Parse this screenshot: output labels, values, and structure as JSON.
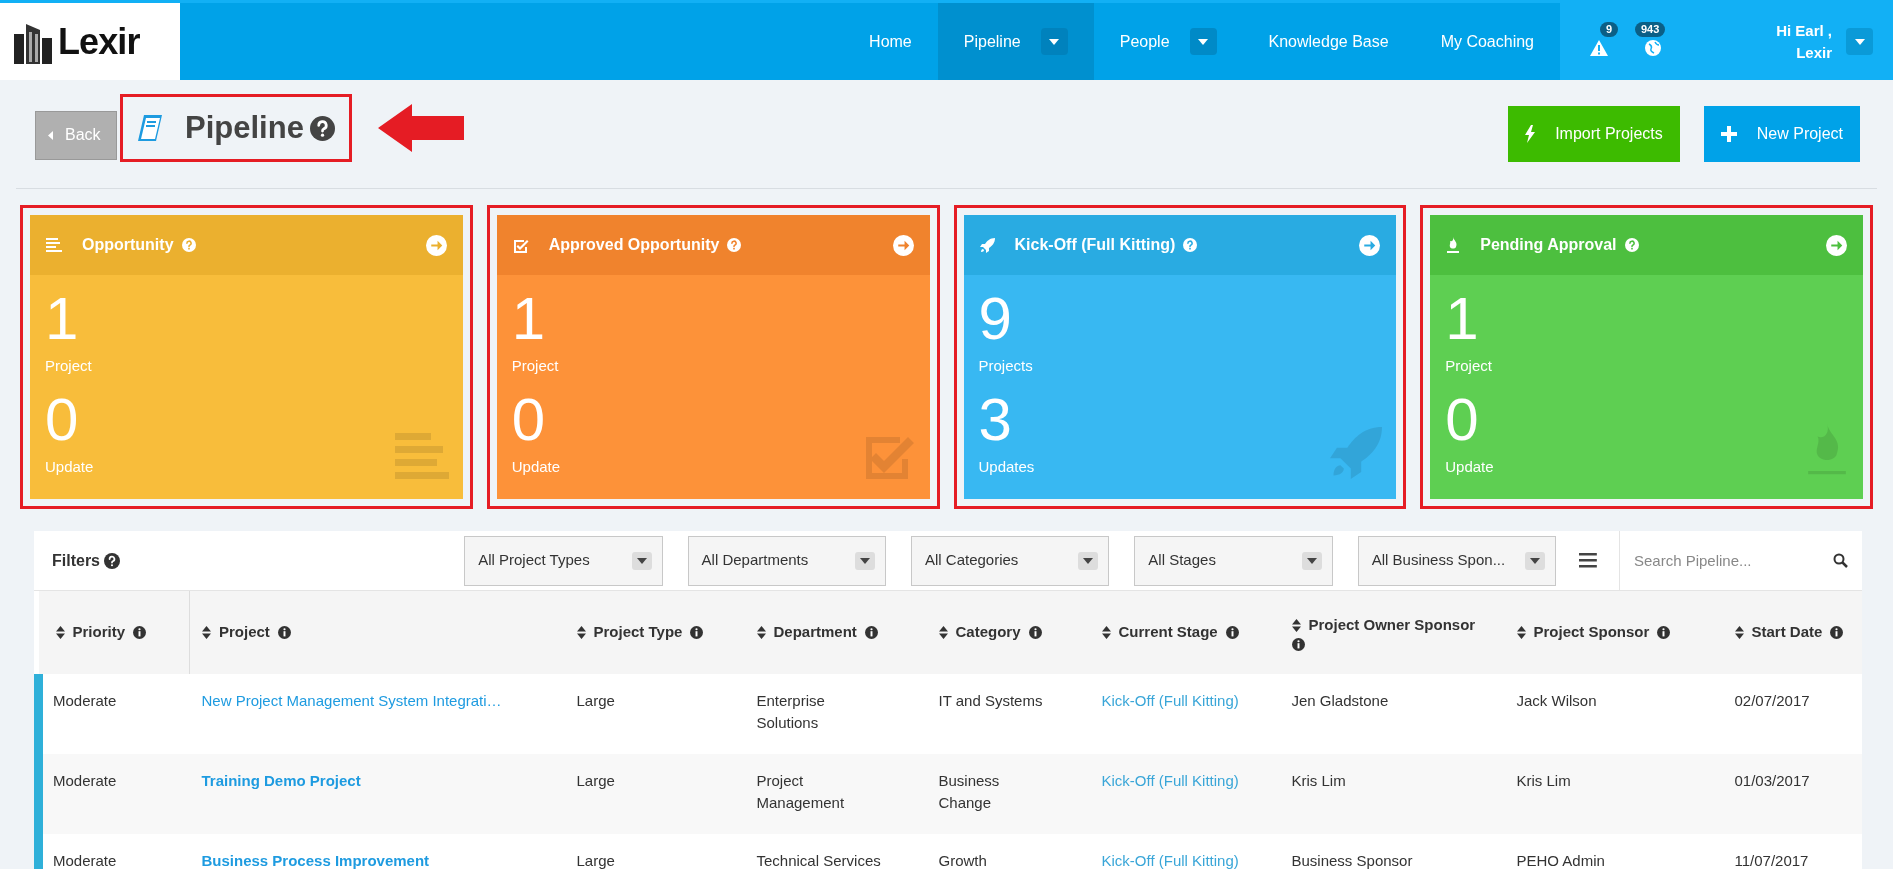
{
  "nav": {
    "logo": "Lexir",
    "items": [
      {
        "label": "Home",
        "selected": false,
        "dropdown": false
      },
      {
        "label": "Pipeline",
        "selected": true,
        "dropdown": true
      },
      {
        "label": "People",
        "selected": false,
        "dropdown": true
      },
      {
        "label": "Knowledge Base",
        "selected": false,
        "dropdown": false
      },
      {
        "label": "My Coaching",
        "selected": false,
        "dropdown": false
      }
    ],
    "alerts": [
      {
        "kind": "warning",
        "count": "9"
      },
      {
        "kind": "globe",
        "count": "943"
      }
    ],
    "user": {
      "greeting": "Hi Earl ,",
      "name": "Lexir"
    }
  },
  "header": {
    "back": "Back",
    "title": "Pipeline",
    "buttons": [
      {
        "kind": "import",
        "label": "Import Projects"
      },
      {
        "kind": "new",
        "label": "New Project"
      }
    ]
  },
  "cards": [
    {
      "kind": "opportunity",
      "title": "Opportunity",
      "count": "1",
      "count_label": "Project",
      "updates": "0",
      "updates_label": "Update"
    },
    {
      "kind": "approved",
      "title": "Approved Opportunity",
      "count": "1",
      "count_label": "Project",
      "updates": "0",
      "updates_label": "Update"
    },
    {
      "kind": "kickoff",
      "title": "Kick-Off (Full Kitting)",
      "count": "9",
      "count_label": "Projects",
      "updates": "3",
      "updates_label": "Updates"
    },
    {
      "kind": "pending",
      "title": "Pending Approval",
      "count": "1",
      "count_label": "Project",
      "updates": "0",
      "updates_label": "Update"
    }
  ],
  "filters": {
    "label": "Filters",
    "selects": [
      "All Project Types",
      "All Departments",
      "All Categories",
      "All Stages",
      "All Business Spon..."
    ],
    "search_placeholder": "Search Pipeline..."
  },
  "table": {
    "columns": [
      {
        "label": "Priority",
        "kind": "text"
      },
      {
        "label": "Project",
        "kind": "project"
      },
      {
        "label": "Project Type",
        "kind": "text"
      },
      {
        "label": "Department",
        "kind": "dept"
      },
      {
        "label": "Category",
        "kind": "cat"
      },
      {
        "label": "Current Stage",
        "kind": "stage"
      },
      {
        "label": "Project Owner Sponsor",
        "kind": "text"
      },
      {
        "label": "Project Sponsor",
        "kind": "text"
      },
      {
        "label": "Start Date",
        "kind": "text"
      }
    ],
    "rows": [
      {
        "bold": false,
        "cells": [
          "Moderate",
          "New Project Management System Integrati…",
          "Large",
          "Enterprise Solutions",
          "IT and Systems",
          "Kick-Off (Full Kitting)",
          "Jen Gladstone",
          "Jack Wilson",
          "02/07/2017"
        ]
      },
      {
        "bold": true,
        "cells": [
          "Moderate",
          "Training Demo Project",
          "Large",
          "Project Management",
          "Business Change",
          "Kick-Off (Full Kitting)",
          "Kris Lim",
          "Kris Lim",
          "01/03/2017"
        ]
      },
      {
        "bold": true,
        "cells": [
          "Moderate",
          "Business Process Improvement",
          "Large",
          "Technical Services",
          "Growth",
          "Kick-Off (Full Kitting)",
          "Business Sponsor",
          "PEHO Admin",
          "11/07/2017"
        ]
      }
    ]
  }
}
